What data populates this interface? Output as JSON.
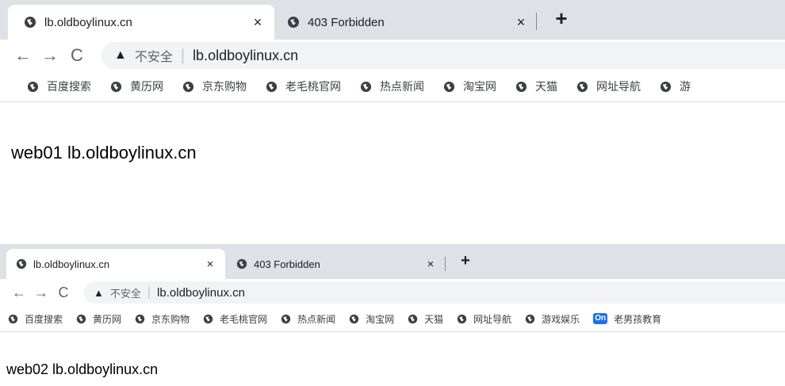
{
  "screenshot_top": {
    "tabs": [
      {
        "title": "lb.oldboylinux.cn",
        "close": "×",
        "active": true
      },
      {
        "title": "403 Forbidden",
        "close": "×",
        "active": false
      }
    ],
    "new_tab": "+",
    "nav": {
      "back": "←",
      "forward": "→",
      "reload": "C"
    },
    "address": {
      "warning_icon": "▲",
      "security_label": "不安全",
      "divider": "|",
      "url": "lb.oldboylinux.cn"
    },
    "bookmarks": [
      "百度搜索",
      "黄历网",
      "京东购物",
      "老毛桃官网",
      "热点新闻",
      "淘宝网",
      "天猫",
      "网址导航",
      "游"
    ],
    "page_text": "web01 lb.oldboylinux.cn"
  },
  "screenshot_bottom": {
    "tabs": [
      {
        "title": "lb.oldboylinux.cn",
        "close": "×",
        "active": true
      },
      {
        "title": "403 Forbidden",
        "close": "×",
        "active": false
      }
    ],
    "new_tab": "+",
    "nav": {
      "back": "←",
      "forward": "→",
      "reload": "C"
    },
    "address": {
      "warning_icon": "▲",
      "security_label": "不安全",
      "divider": "|",
      "url": "lb.oldboylinux.cn"
    },
    "bookmarks": [
      "百度搜索",
      "黄历网",
      "京东购物",
      "老毛桃官网",
      "热点新闻",
      "淘宝网",
      "天猫",
      "网址导航",
      "游戏娱乐"
    ],
    "extra_bookmark": {
      "badge": "On",
      "label": "老男孩教育"
    },
    "page_text": "web02 lb.oldboylinux.cn"
  },
  "colors": {
    "tabstrip": "#dee1e6",
    "omnibox": "#f1f3f4",
    "on_badge": "#1a73e8"
  }
}
